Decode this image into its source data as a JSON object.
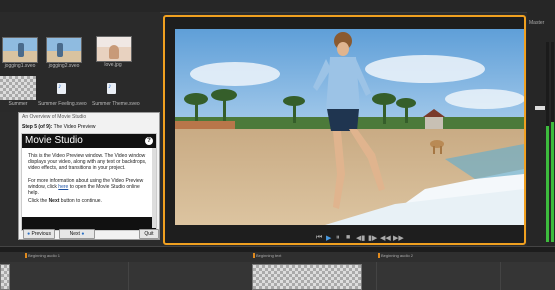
{
  "colors": {
    "accent": "#f0a020",
    "meter": "#3dbb3d",
    "marker": "#e08a1e"
  },
  "media_bin": {
    "items": [
      {
        "caption": "jogging1.sveo",
        "kind": "video"
      },
      {
        "caption": "jogging2.sveo",
        "kind": "video"
      },
      {
        "caption": "love.jpg",
        "kind": "image"
      },
      {
        "caption": "Summer",
        "kind": "transparent"
      },
      {
        "caption": "Summer Feeling.sveo",
        "kind": "audio"
      },
      {
        "caption": "Summer Theme.sveo",
        "kind": "audio"
      }
    ]
  },
  "dialog": {
    "title": "An Overview of Movie Studio",
    "step_bold": "Step 5 (of 9):",
    "step_text": "The Video Preview",
    "heading": "Movie Studio",
    "help": "?",
    "para1": "This is the Video Preview window. The Video window displays your video, along with any text or backdrops, video effects, and transitions in your project.",
    "para2_a": "For more information about using the Video Preview window, click ",
    "para2_link": "here",
    "para2_b": " to open the Movie Studio online help.",
    "para3_a": "Click the ",
    "para3_bold": "Next",
    "para3_b": " button to continue.",
    "previous_label": "Previous",
    "next_label": "Next",
    "quit_label": "Quit"
  },
  "preview": {
    "transport_icons": [
      "rewind-icon",
      "play-icon",
      "pause-icon",
      "stop-icon",
      "prev-frame-icon",
      "next-frame-icon",
      "loop-icon",
      "end-icon"
    ]
  },
  "mixer": {
    "label": "Master",
    "level_left": 0.58,
    "level_right": 0.6
  },
  "timeline": {
    "markers": [
      "Beginning audio 1",
      "Beginning text",
      "Beginning audio 2"
    ]
  }
}
